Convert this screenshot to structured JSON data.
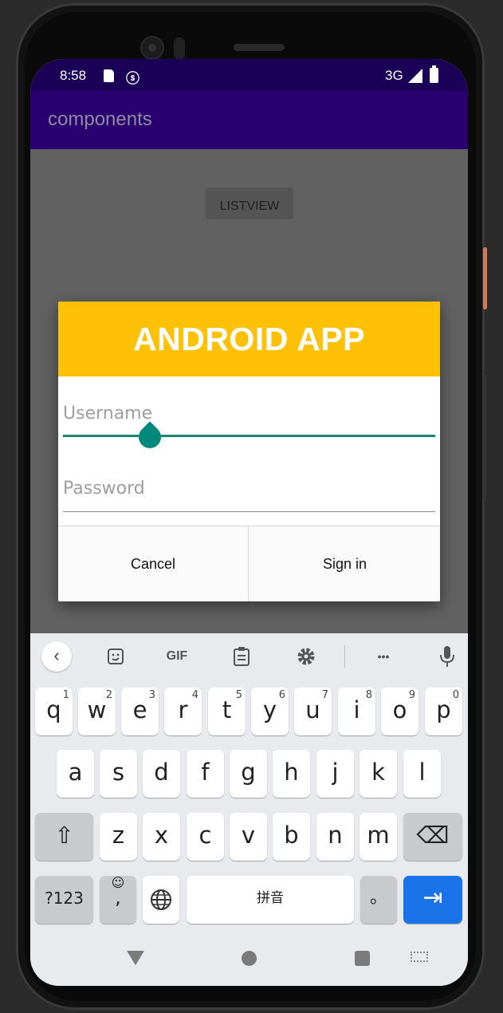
{
  "status_bar": {
    "time": "8:58",
    "network": "3G",
    "left_icons": [
      "sd-card-icon",
      "notification-s-icon"
    ],
    "right_icons": [
      "signal-icon",
      "battery-icon"
    ]
  },
  "app_bar": {
    "title": "components"
  },
  "content": {
    "listview_button": "LISTVIEW"
  },
  "dialog": {
    "title": "ANDROID APP",
    "username_placeholder": "Username",
    "password_placeholder": "Password",
    "cancel_label": "Cancel",
    "signin_label": "Sign in"
  },
  "colors": {
    "accent": "#ffc107",
    "app_bar": "#2a0070",
    "status_bar": "#1b0057",
    "input_focus": "#1a8577",
    "key_action": "#1a73e8"
  },
  "keyboard": {
    "toolbar": {
      "gif": "GIF",
      "more": "•••"
    },
    "row1": [
      {
        "k": "q",
        "h": "1"
      },
      {
        "k": "w",
        "h": "2"
      },
      {
        "k": "e",
        "h": "3"
      },
      {
        "k": "r",
        "h": "4"
      },
      {
        "k": "t",
        "h": "5"
      },
      {
        "k": "y",
        "h": "6"
      },
      {
        "k": "u",
        "h": "7"
      },
      {
        "k": "i",
        "h": "8"
      },
      {
        "k": "o",
        "h": "9"
      },
      {
        "k": "p",
        "h": "0"
      }
    ],
    "row2": [
      "a",
      "s",
      "d",
      "f",
      "g",
      "h",
      "j",
      "k",
      "l"
    ],
    "row3": [
      "z",
      "x",
      "c",
      "v",
      "b",
      "n",
      "m"
    ],
    "symbols": "?123",
    "comma": ",",
    "emoji": "☺",
    "space": "拼音",
    "period": "。",
    "shift_icon": "⇧",
    "backspace_icon": "⌫",
    "enter_icon": "⇥",
    "globe_icon": "🌐"
  }
}
